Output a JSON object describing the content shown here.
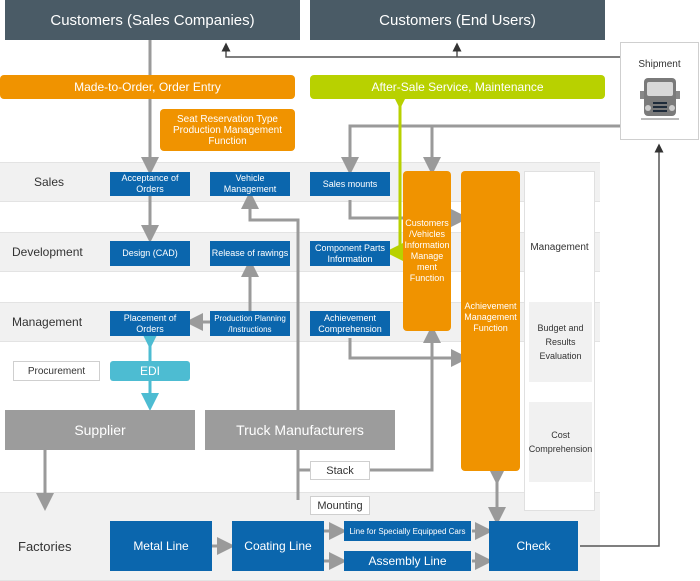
{
  "top": {
    "customers_sales": "Customers (Sales Companies)",
    "customers_end": "Customers (End Users)",
    "shipment": "Shipment",
    "made_to_order": "Made-to-Order, Order Entry",
    "after_sale": "After-Sale Service, Maintenance",
    "seat_reservation": "Seat Reservation Type Production Management Function"
  },
  "rows": {
    "sales": "Sales",
    "development": "Development",
    "management": "Management",
    "factories": "Factories"
  },
  "nodes": {
    "acceptance_orders": "Acceptance of Orders",
    "vehicle_management": "Vehicle Management",
    "sales_mounts": "Sales mounts",
    "design_cad": "Design (CAD)",
    "release_drawings": "Release of rawings",
    "component_parts": "Component Parts Information",
    "placement_orders": "Placement of Orders",
    "production_planning": "Production Planning /Instructions",
    "achievement_comprehension": "Achievement Comprehension",
    "customers_vehicles_info": "Customers /Vehicles Information Manage ment Function",
    "achievement_mgmt_function": "Achievement Management Function",
    "management_panel": "Management",
    "budget_results": "Budget and Results Evaluation",
    "cost_comprehension": "Cost Comprehension",
    "procurement": "Procurement",
    "edi": "EDI",
    "supplier": "Supplier",
    "truck_manufacturers": "Truck Manufacturers",
    "stack": "Stack",
    "mounting": "Mounting",
    "metal_line": "Metal Line",
    "coating_line": "Coating Line",
    "special_cars_line": "Line for Specially Equipped Cars",
    "assembly_line": "Assembly Line",
    "check": "Check"
  },
  "colors": {
    "dark_header": "#4a5b66",
    "orange": "#f09300",
    "lime": "#b8d100",
    "blue": "#0b66ad",
    "edi": "#4dbcd2",
    "gray_block": "#9c9c9c",
    "arrow_gray": "#9a9a9a"
  },
  "icons": {
    "shipment": "truck-icon"
  }
}
